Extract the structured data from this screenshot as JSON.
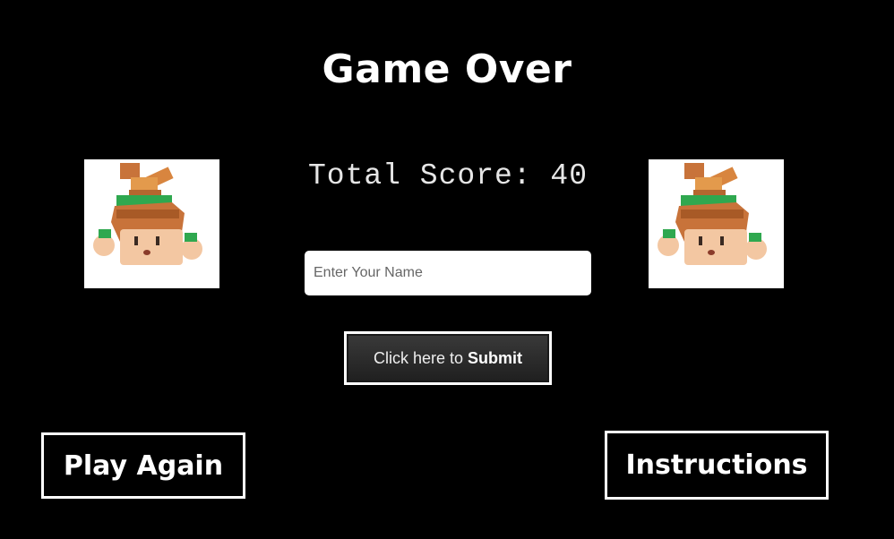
{
  "title": "Game Over",
  "score": {
    "text": "Total Score: 40"
  },
  "name_input": {
    "placeholder": "Enter Your Name",
    "value": ""
  },
  "submit": {
    "prefix": "Click here to",
    "bold": "Submit"
  },
  "buttons": {
    "play_again": "Play Again",
    "instructions": "Instructions"
  },
  "icons": {
    "character": "upside-down-character-icon"
  },
  "colors": {
    "background": "#000000",
    "text": "#ffffff",
    "button_fill": "#2b2b2b",
    "character_hair": "#c8733a",
    "character_shirt": "#2fa84f",
    "character_skin": "#f3c7a2"
  }
}
